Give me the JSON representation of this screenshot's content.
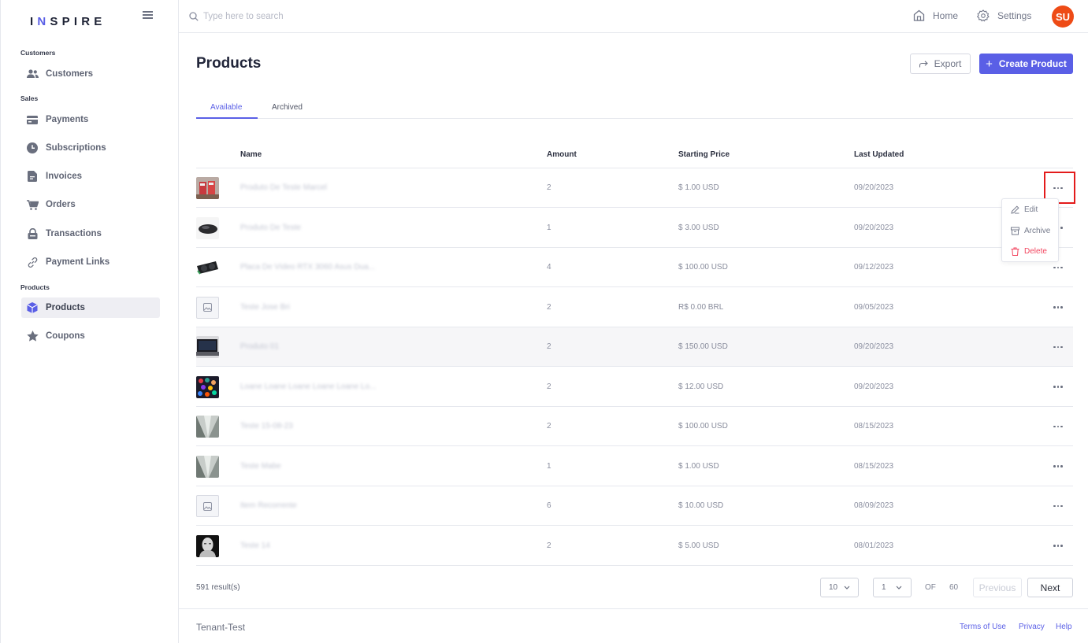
{
  "brand": {
    "logo_text": "INSPIRE",
    "accent_color": "#5a5fe6"
  },
  "sidebar": {
    "sections": [
      {
        "label": "Customers"
      },
      {
        "label": "Sales"
      },
      {
        "label": "Products"
      }
    ],
    "items": [
      {
        "label": "Customers",
        "icon": "users-icon"
      },
      {
        "label": "Payments",
        "icon": "credit-card-icon"
      },
      {
        "label": "Subscriptions",
        "icon": "clock-icon"
      },
      {
        "label": "Invoices",
        "icon": "document-icon"
      },
      {
        "label": "Orders",
        "icon": "cart-icon"
      },
      {
        "label": "Transactions",
        "icon": "lock-icon"
      },
      {
        "label": "Payment Links",
        "icon": "link-icon"
      },
      {
        "label": "Products",
        "icon": "cube-icon",
        "active": true
      },
      {
        "label": "Coupons",
        "icon": "star-icon"
      }
    ]
  },
  "topbar": {
    "search_placeholder": "Type here to search",
    "home_label": "Home",
    "settings_label": "Settings",
    "avatar_initials": "SU",
    "avatar_color": "#ee4b16"
  },
  "page": {
    "title": "Products",
    "export_label": "Export",
    "create_label": "Create Product"
  },
  "tabs": [
    {
      "label": "Available",
      "active": true
    },
    {
      "label": "Archived",
      "active": false
    }
  ],
  "table": {
    "columns": [
      "Name",
      "Amount",
      "Starting Price",
      "Last Updated"
    ],
    "rows": [
      {
        "name": "Produto De Teste Marcel",
        "amount": "2",
        "price": "$ 1.00 USD",
        "updated": "09/20/2023",
        "thumb": "sneakers"
      },
      {
        "name": "Produto De Teste",
        "amount": "1",
        "price": "$ 3.00 USD",
        "updated": "09/20/2023",
        "thumb": "mouse"
      },
      {
        "name": "Placa De Vídeo RTX 3060 Asus Dua...",
        "amount": "4",
        "price": "$ 100.00 USD",
        "updated": "09/12/2023",
        "thumb": "gpu"
      },
      {
        "name": "Teste Jose Bri",
        "amount": "2",
        "price": "R$ 0.00 BRL",
        "updated": "09/05/2023",
        "thumb": "placeholder"
      },
      {
        "name": "Produto 01",
        "amount": "2",
        "price": "$ 150.00 USD",
        "updated": "09/20/2023",
        "thumb": "laptop"
      },
      {
        "name": "Loane Loane Loane Loane Loane Lo...",
        "amount": "2",
        "price": "$ 12.00 USD",
        "updated": "09/20/2023",
        "thumb": "colorful"
      },
      {
        "name": "Teste 15-08-23",
        "amount": "2",
        "price": "$ 100.00 USD",
        "updated": "08/15/2023",
        "thumb": "sky"
      },
      {
        "name": "Teste Mabe",
        "amount": "1",
        "price": "$ 1.00 USD",
        "updated": "08/15/2023",
        "thumb": "sky"
      },
      {
        "name": "Item Recorrente",
        "amount": "6",
        "price": "$ 10.00 USD",
        "updated": "08/09/2023",
        "thumb": "placeholder"
      },
      {
        "name": "Teste 14",
        "amount": "2",
        "price": "$ 5.00 USD",
        "updated": "08/01/2023",
        "thumb": "portrait"
      }
    ]
  },
  "row_menu": {
    "edit": "Edit",
    "archive": "Archive",
    "delete": "Delete"
  },
  "pagination": {
    "results": "591 result(s)",
    "page_size": "10",
    "current_page": "1",
    "of_label": "OF",
    "total_pages": "60",
    "previous_label": "Previous",
    "next_label": "Next"
  },
  "footer": {
    "tenant": "Tenant-Test",
    "links": [
      "Terms of Use",
      "Privacy",
      "Help"
    ]
  }
}
